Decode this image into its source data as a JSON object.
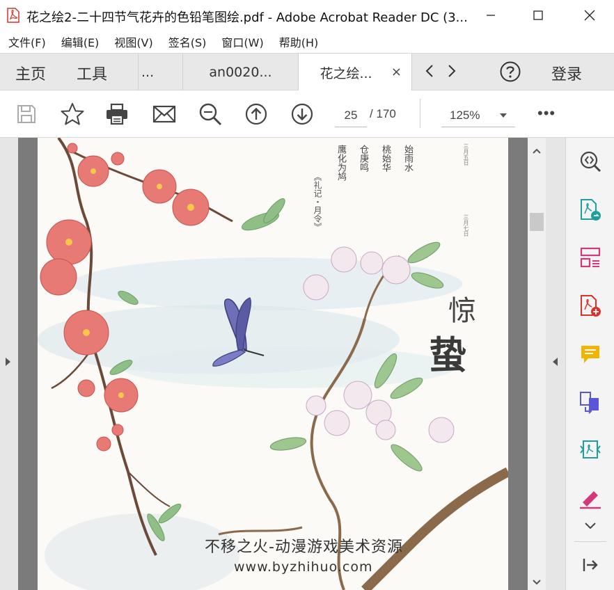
{
  "window": {
    "title": "花之绘2-二十四节气花卉的色铅笔图绘.pdf - Adobe Acrobat Reader DC (3..."
  },
  "menu": [
    "文件(F)",
    "编辑(E)",
    "视图(V)",
    "签名(S)",
    "窗口(W)",
    "帮助(H)"
  ],
  "tabs": {
    "home": "主页",
    "tools": "工具",
    "partial_tab": "...",
    "doc_tab_2": "an0020...",
    "active_tab": "花之绘...",
    "close_glyph": "×",
    "login": "登录"
  },
  "toolbar": {
    "page_current": "25",
    "page_total": "/ 170",
    "zoom": "125%",
    "more": "•••"
  },
  "page_content": {
    "poem_col1": "始雨水",
    "poem_col2": "桃始华",
    "poem_col3": "仓庚鸣",
    "poem_col4": "鹰化为鸠",
    "source": "《礼记・月令》",
    "date_top": "三月五日",
    "date_bottom": "三月七日",
    "title_1": "惊",
    "title_2": "蛰",
    "watermark_line1": "不移之火-动漫游戏美术资源",
    "watermark_line2": "www.byzhihuo.com"
  },
  "colors": {
    "pdf_red": "#d9342b",
    "tool_teal": "#1f9e9e",
    "tool_pink": "#d2387a",
    "tool_red": "#d9342b",
    "tool_yellow": "#f2b400",
    "tool_purple": "#5a57d6"
  }
}
